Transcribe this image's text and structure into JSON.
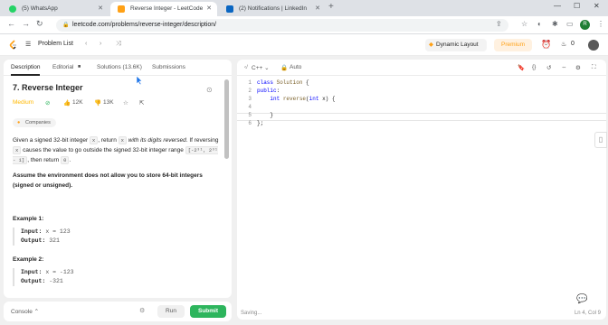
{
  "browser": {
    "tabs": [
      {
        "title": "(5) WhatsApp",
        "active": false
      },
      {
        "title": "Reverse Integer - LeetCode",
        "active": true
      },
      {
        "title": "(2) Notifications | LinkedIn",
        "active": false
      }
    ],
    "url": "leetcode.com/problems/reverse-integer/description/",
    "profile_initial": "R"
  },
  "topnav": {
    "problem_list": "Problem List",
    "dynamic_layout": "Dynamic Layout",
    "premium": "Premium",
    "notif_count": "0"
  },
  "left_tabs": {
    "description": "Description",
    "editorial": "Editorial",
    "solutions": "Solutions (13.6K)",
    "submissions": "Submissions"
  },
  "problem": {
    "title": "7. Reverse Integer",
    "difficulty": "Medium",
    "likes": "12K",
    "dislikes": "13K",
    "companies": "Companies",
    "desc_1a": "Given a signed 32-bit integer ",
    "code_x": "x",
    "desc_1b": ", return ",
    "desc_1c": " with its digits reversed",
    "desc_1d": ". If reversing ",
    "desc_1e": " causes the value to go outside the signed 32-bit integer range ",
    "range": "[-2³¹, 2³¹ - 1]",
    "desc_1f": ", then return ",
    "zero": "0",
    "desc_1g": ".",
    "note": "Assume the environment does not allow you to store 64-bit integers (signed or unsigned).",
    "examples": [
      {
        "title": "Example 1:",
        "input_label": "Input:",
        "input": "x = 123",
        "output_label": "Output:",
        "output": "321"
      },
      {
        "title": "Example 2:",
        "input_label": "Input:",
        "input": "x = -123",
        "output_label": "Output:",
        "output": "-321"
      }
    ]
  },
  "bottom": {
    "console": "Console",
    "run": "Run",
    "submit": "Submit"
  },
  "editor": {
    "language": "C++",
    "mode": "Auto",
    "status_left": "Saving...",
    "status_right": "Ln 4, Col 9",
    "lines": [
      {
        "n": "1",
        "text": "class Solution {"
      },
      {
        "n": "2",
        "text": "public:"
      },
      {
        "n": "3",
        "text": "    int reverse(int x) {"
      },
      {
        "n": "4",
        "text": ""
      },
      {
        "n": "5",
        "text": "    }"
      },
      {
        "n": "6",
        "text": "};"
      }
    ]
  },
  "colors": {
    "accent": "#ffa116",
    "medium": "#ffb800",
    "green": "#2db55d"
  }
}
